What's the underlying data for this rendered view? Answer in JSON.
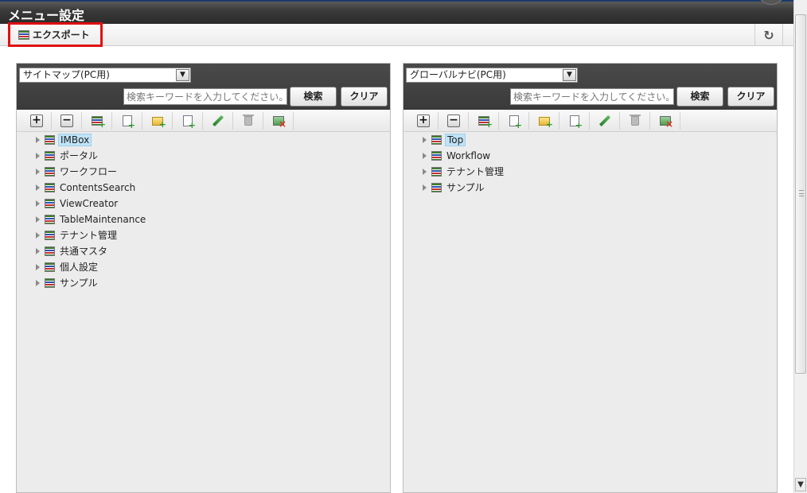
{
  "page": {
    "title": "メニュー設定"
  },
  "toolbar": {
    "export_label": "エクスポート",
    "refresh_icon": "refresh-icon"
  },
  "left_panel": {
    "select_value": "サイトマップ(PC用)",
    "search_placeholder": "検索キーワードを入力してください。",
    "search_label": "検索",
    "clear_label": "クリア",
    "tree": [
      "IMBox",
      "ポータル",
      "ワークフロー",
      "ContentsSearch",
      "ViewCreator",
      "TableMaintenance",
      "テナント管理",
      "共通マスタ",
      "個人設定",
      "サンプル"
    ]
  },
  "right_panel": {
    "select_value": "グローバルナビ(PC用)",
    "search_placeholder": "検索キーワードを入力してください。",
    "search_label": "検索",
    "clear_label": "クリア",
    "tree": [
      "Top",
      "Workflow",
      "テナント管理",
      "サンプル"
    ]
  },
  "icons": [
    "expand-all-icon",
    "collapse-all-icon",
    "add-menu-icon",
    "add-page-icon",
    "add-folder-icon",
    "add-document-icon",
    "edit-icon",
    "delete-icon",
    "remove-image-icon"
  ]
}
